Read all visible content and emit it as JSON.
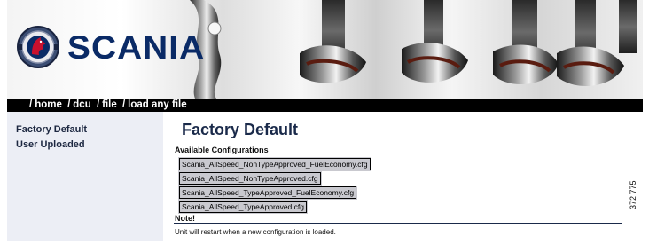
{
  "header": {
    "brand_name": "SCANIA",
    "logo_icon": "scania-griffin-logo-icon",
    "colors": {
      "brand_blue": "#0a2a66",
      "logo_red": "#c8102e",
      "logo_ring": "#5a6d8f"
    }
  },
  "breadcrumb": {
    "separator": "/",
    "items": [
      {
        "label": "home"
      },
      {
        "label": "dcu"
      },
      {
        "label": "file"
      },
      {
        "label": "load any file"
      }
    ]
  },
  "sidebar": {
    "items": [
      {
        "label": "Factory Default"
      },
      {
        "label": "User Uploaded"
      }
    ]
  },
  "main": {
    "title": "Factory Default",
    "configs_heading": "Available Configurations",
    "configs": [
      "Scania_AllSpeed_NonTypeApproved_FuelEconomy.cfg",
      "Scania_AllSpeed_NonTypeApproved.cfg",
      "Scania_AllSpeed_TypeApproved_FuelEconomy.cfg",
      "Scania_AllSpeed_TypeApproved.cfg"
    ],
    "note_heading": "Note!",
    "note_text": "Unit will restart when a new configuration is loaded."
  },
  "figure_number": "372 775"
}
